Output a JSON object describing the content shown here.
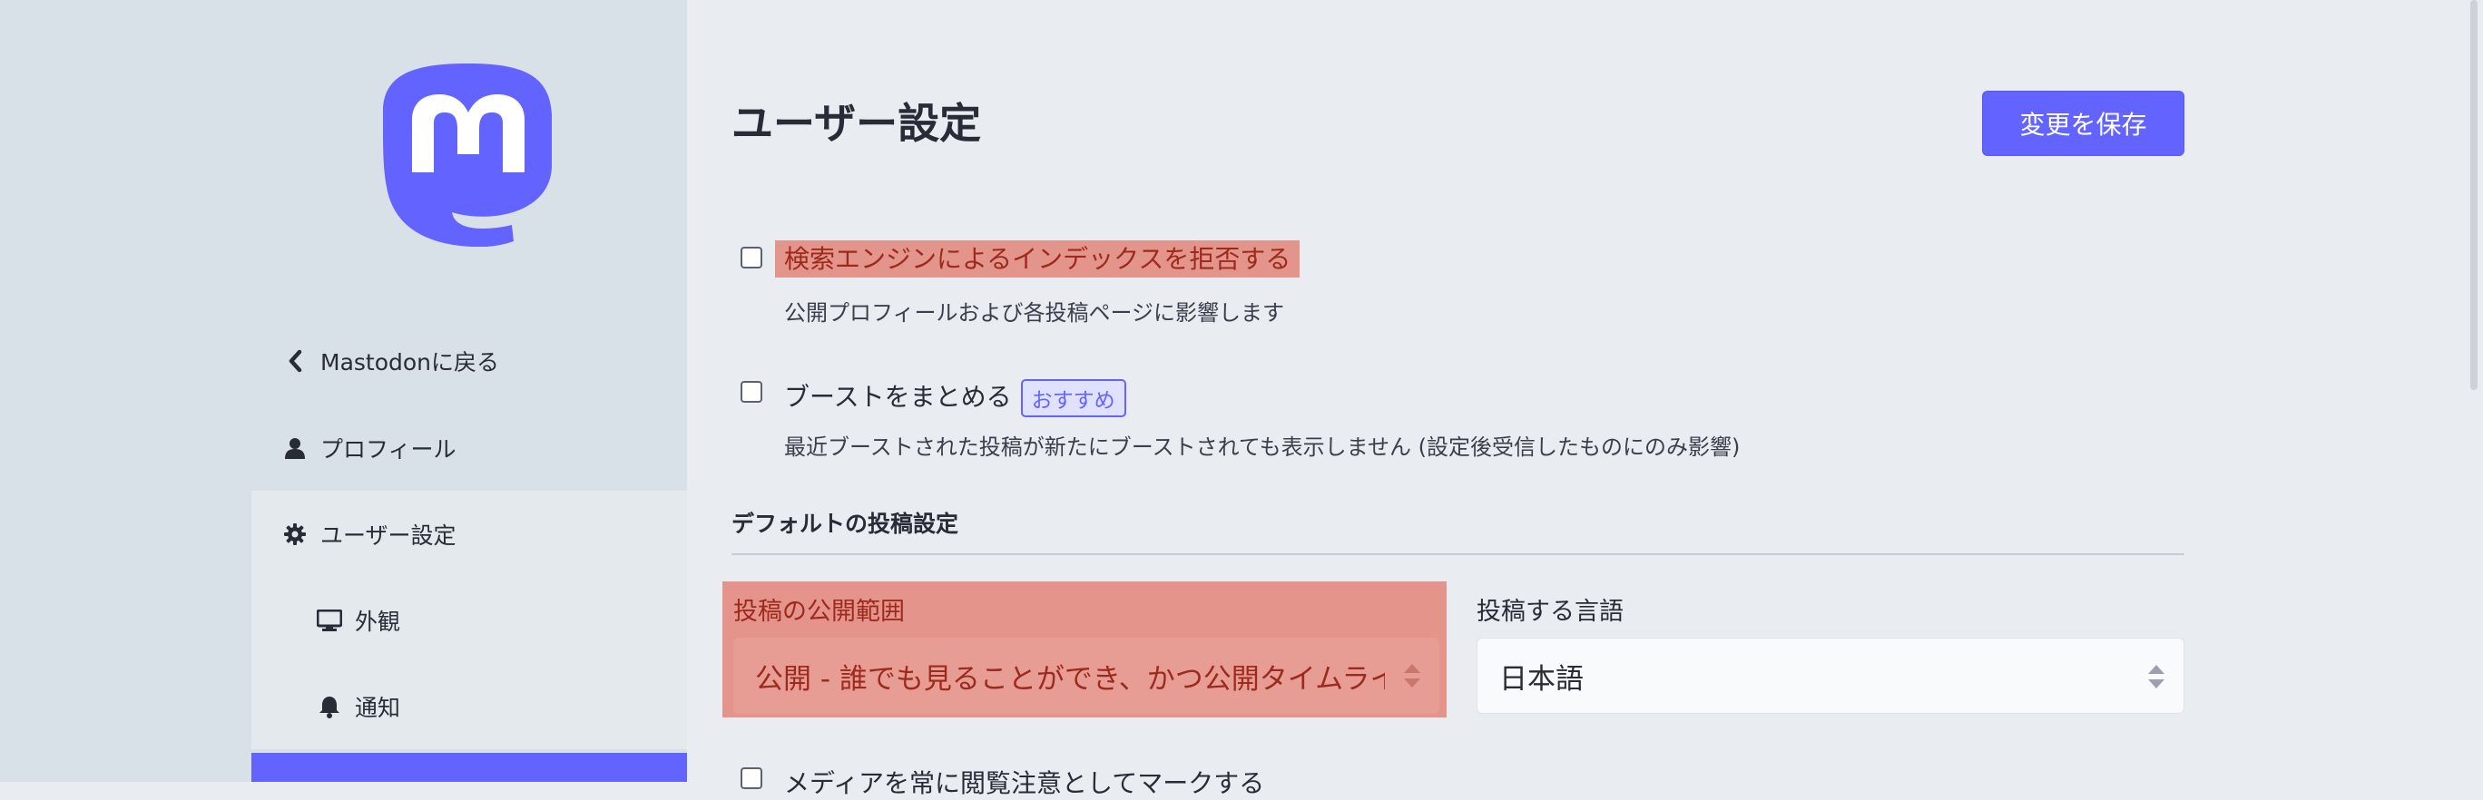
{
  "sidebar": {
    "logo": "mastodon-logo",
    "back": {
      "icon": "chevron-left-icon",
      "label": "Mastodonに戻る"
    },
    "profile": {
      "icon": "user-icon",
      "label": "プロフィール"
    },
    "preferences": {
      "icon": "gear-icon",
      "label": "ユーザー設定"
    },
    "appearance": {
      "icon": "desktop-icon",
      "label": "外観"
    },
    "notifications": {
      "icon": "bell-icon",
      "label": "通知"
    }
  },
  "header": {
    "title": "ユーザー設定",
    "save_label": "変更を保存"
  },
  "options": {
    "noindex": {
      "label": "検索エンジンによるインデックスを拒否する",
      "hint": "公開プロフィールおよび各投稿ページに影響します",
      "checked": false
    },
    "aggregate_reblogs": {
      "label": "ブーストをまとめる",
      "badge": "おすすめ",
      "hint": "最近ブーストされた投稿が新たにブーストされても表示しません (設定後受信したものにのみ影響)",
      "checked": false
    }
  },
  "posting": {
    "section_title": "デフォルトの投稿設定",
    "privacy_label": "投稿の公開範囲",
    "privacy_value": "公開 - 誰でも見ることができ、かつ公開タイムラインにも表示されます",
    "language_label": "投稿する言語",
    "language_value": "日本語",
    "sensitive_label": "メディアを常に閲覧注意としてマークする"
  },
  "colors": {
    "accent": "#6364ff",
    "highlight": "#e4958b",
    "sidebar_bg": "#d9e1e8",
    "main_bg": "#e9ecf0"
  }
}
